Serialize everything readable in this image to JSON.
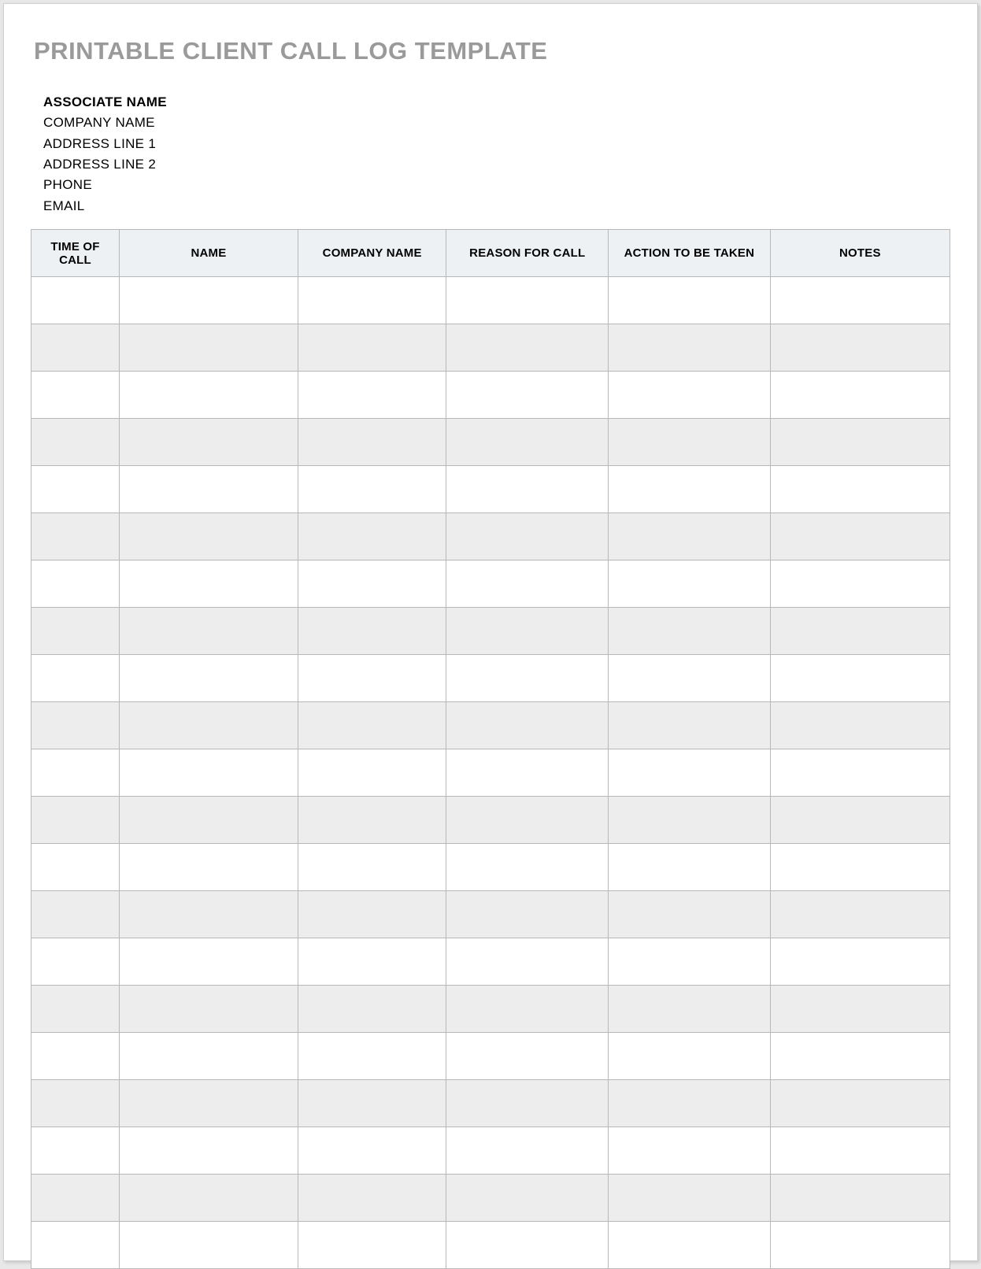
{
  "title": "PRINTABLE CLIENT CALL LOG TEMPLATE",
  "info": {
    "associate": "ASSOCIATE NAME",
    "company": "COMPANY NAME",
    "address1": "ADDRESS LINE 1",
    "address2": "ADDRESS LINE 2",
    "phone": "PHONE",
    "email": "EMAIL"
  },
  "columns": {
    "time": "TIME OF CALL",
    "name": "NAME",
    "company": "COMPANY NAME",
    "reason": "REASON FOR CALL",
    "action": "ACTION TO BE TAKEN",
    "notes": "NOTES"
  },
  "row_count": 21
}
